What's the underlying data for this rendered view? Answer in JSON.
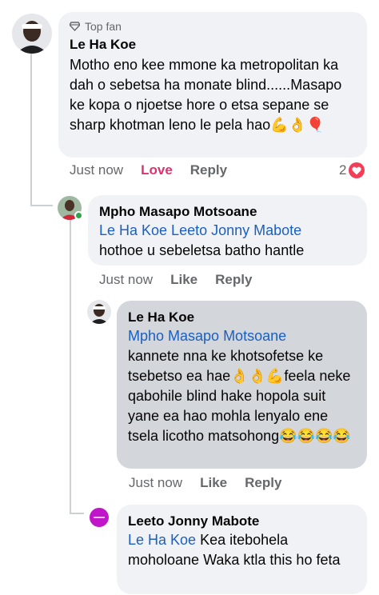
{
  "comments": [
    {
      "badge": "Top fan",
      "author": "Le Ha Koe",
      "text": "Motho eno kee mmone ka metropolitan ka dah o sebetsa ha monate blind......Masapo ke kopa o njoetse hore o etsa sepane se sharp khotman leno le pela hao💪👌🎈",
      "time": "Just now",
      "love_label": "Love",
      "reply_label": "Reply",
      "reaction_count": "2"
    },
    {
      "author": "Mpho Masapo Motsoane",
      "tag": "Le Ha Koe Leeto Jonny Mabote",
      "text": "hothoe u sebeletsa batho hantle",
      "time": "Just now",
      "like_label": "Like",
      "reply_label": "Reply"
    },
    {
      "author": "Le Ha Koe",
      "tag": "Mpho Masapo Motsoane",
      "text": "kannete nna ke khotsofetse ke tsebetso ea hae👌👌💪feela neke qabohile blind hake hopola suit yane ea hao mohla lenyalo ene tsela licotho matsohong😂😂😂😂",
      "time": "Just now",
      "like_label": "Like",
      "reply_label": "Reply"
    },
    {
      "author": "Leeto Jonny Mabote",
      "tag": "Le Ha Koe",
      "text": "Kea itebohela moholoane Waka ktla this ho feta"
    }
  ],
  "colors": {
    "tag": "#1b5fbf",
    "love": "#e1306c",
    "heart": "#f33e58",
    "online": "#31a24c"
  }
}
